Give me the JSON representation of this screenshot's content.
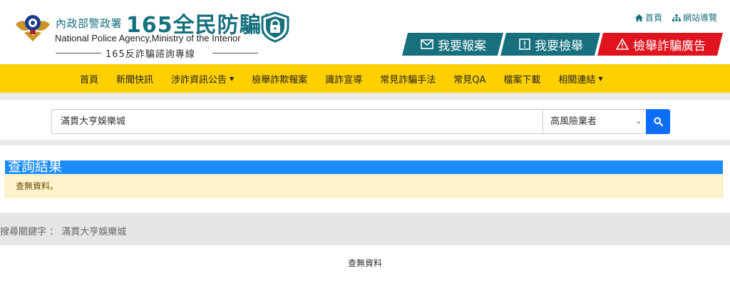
{
  "brand": {
    "agency_cn": "內政部警政署",
    "site_name": "165全民防騙網",
    "agency_en": "National Police Agency,Ministry of the Interior",
    "hotline": "165反詐騙諮詢專線"
  },
  "top_links": {
    "home": "首頁",
    "sitemap": "網站導覽"
  },
  "actions": {
    "report": "我要報案",
    "inform": "我要檢舉",
    "report_ad": "檢舉詐騙廣告"
  },
  "nav": {
    "items": [
      {
        "label": "首頁"
      },
      {
        "label": "新聞快訊"
      },
      {
        "label": "涉詐資訊公告"
      },
      {
        "label": "檢舉詐欺報案"
      },
      {
        "label": "識詐宣導"
      },
      {
        "label": "常見詐騙手法"
      },
      {
        "label": "常見QA"
      },
      {
        "label": "檔案下載"
      },
      {
        "label": "相關連結"
      }
    ]
  },
  "search": {
    "query": "滿貫大亨娛樂城",
    "category": "高風險業者"
  },
  "results": {
    "title": "查詢結果",
    "alert": "查無資料。",
    "keyword_prefix": "搜尋關鍵字 ：",
    "keyword": "滿貫大亨娛樂城",
    "empty": "查無資料"
  },
  "colors": {
    "teal": "#17707e",
    "red": "#e0141e",
    "nav_yellow": "#ffd000",
    "blue": "#1a8cff",
    "alert_bg": "#fff3cd"
  }
}
